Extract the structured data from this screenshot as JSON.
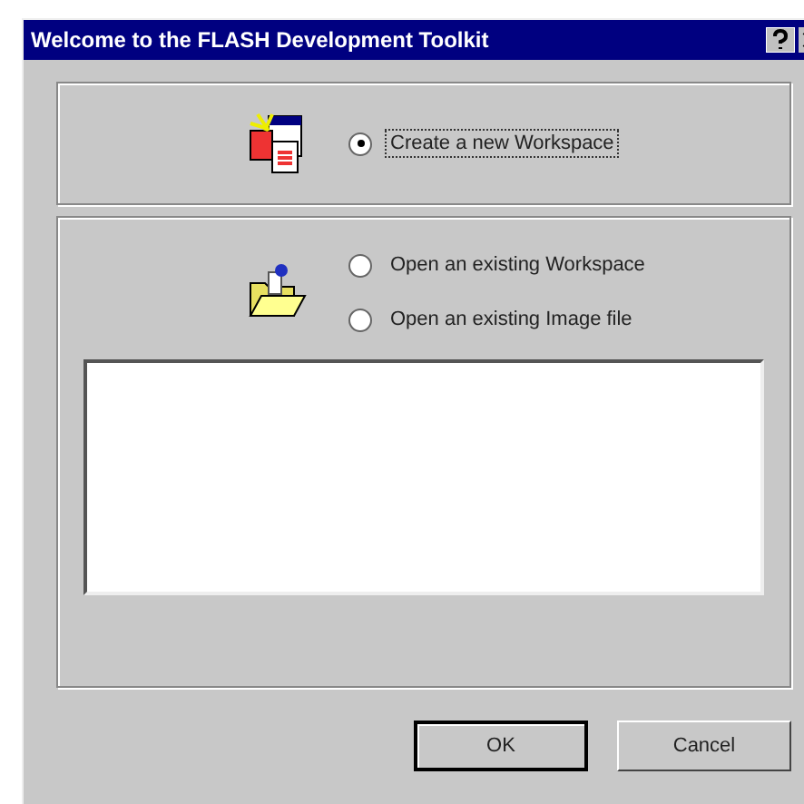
{
  "window": {
    "title": "Welcome to the FLASH Development Toolkit"
  },
  "create_panel": {
    "options": [
      {
        "label": "Create a new Workspace",
        "selected": true,
        "focused": true
      }
    ]
  },
  "open_panel": {
    "options": [
      {
        "label": "Open an existing Workspace",
        "selected": false,
        "focused": false
      },
      {
        "label": "Open an existing Image file",
        "selected": false,
        "focused": false
      }
    ]
  },
  "buttons": [
    {
      "label": "OK",
      "default": true
    },
    {
      "label": "Cancel",
      "default": false
    }
  ]
}
